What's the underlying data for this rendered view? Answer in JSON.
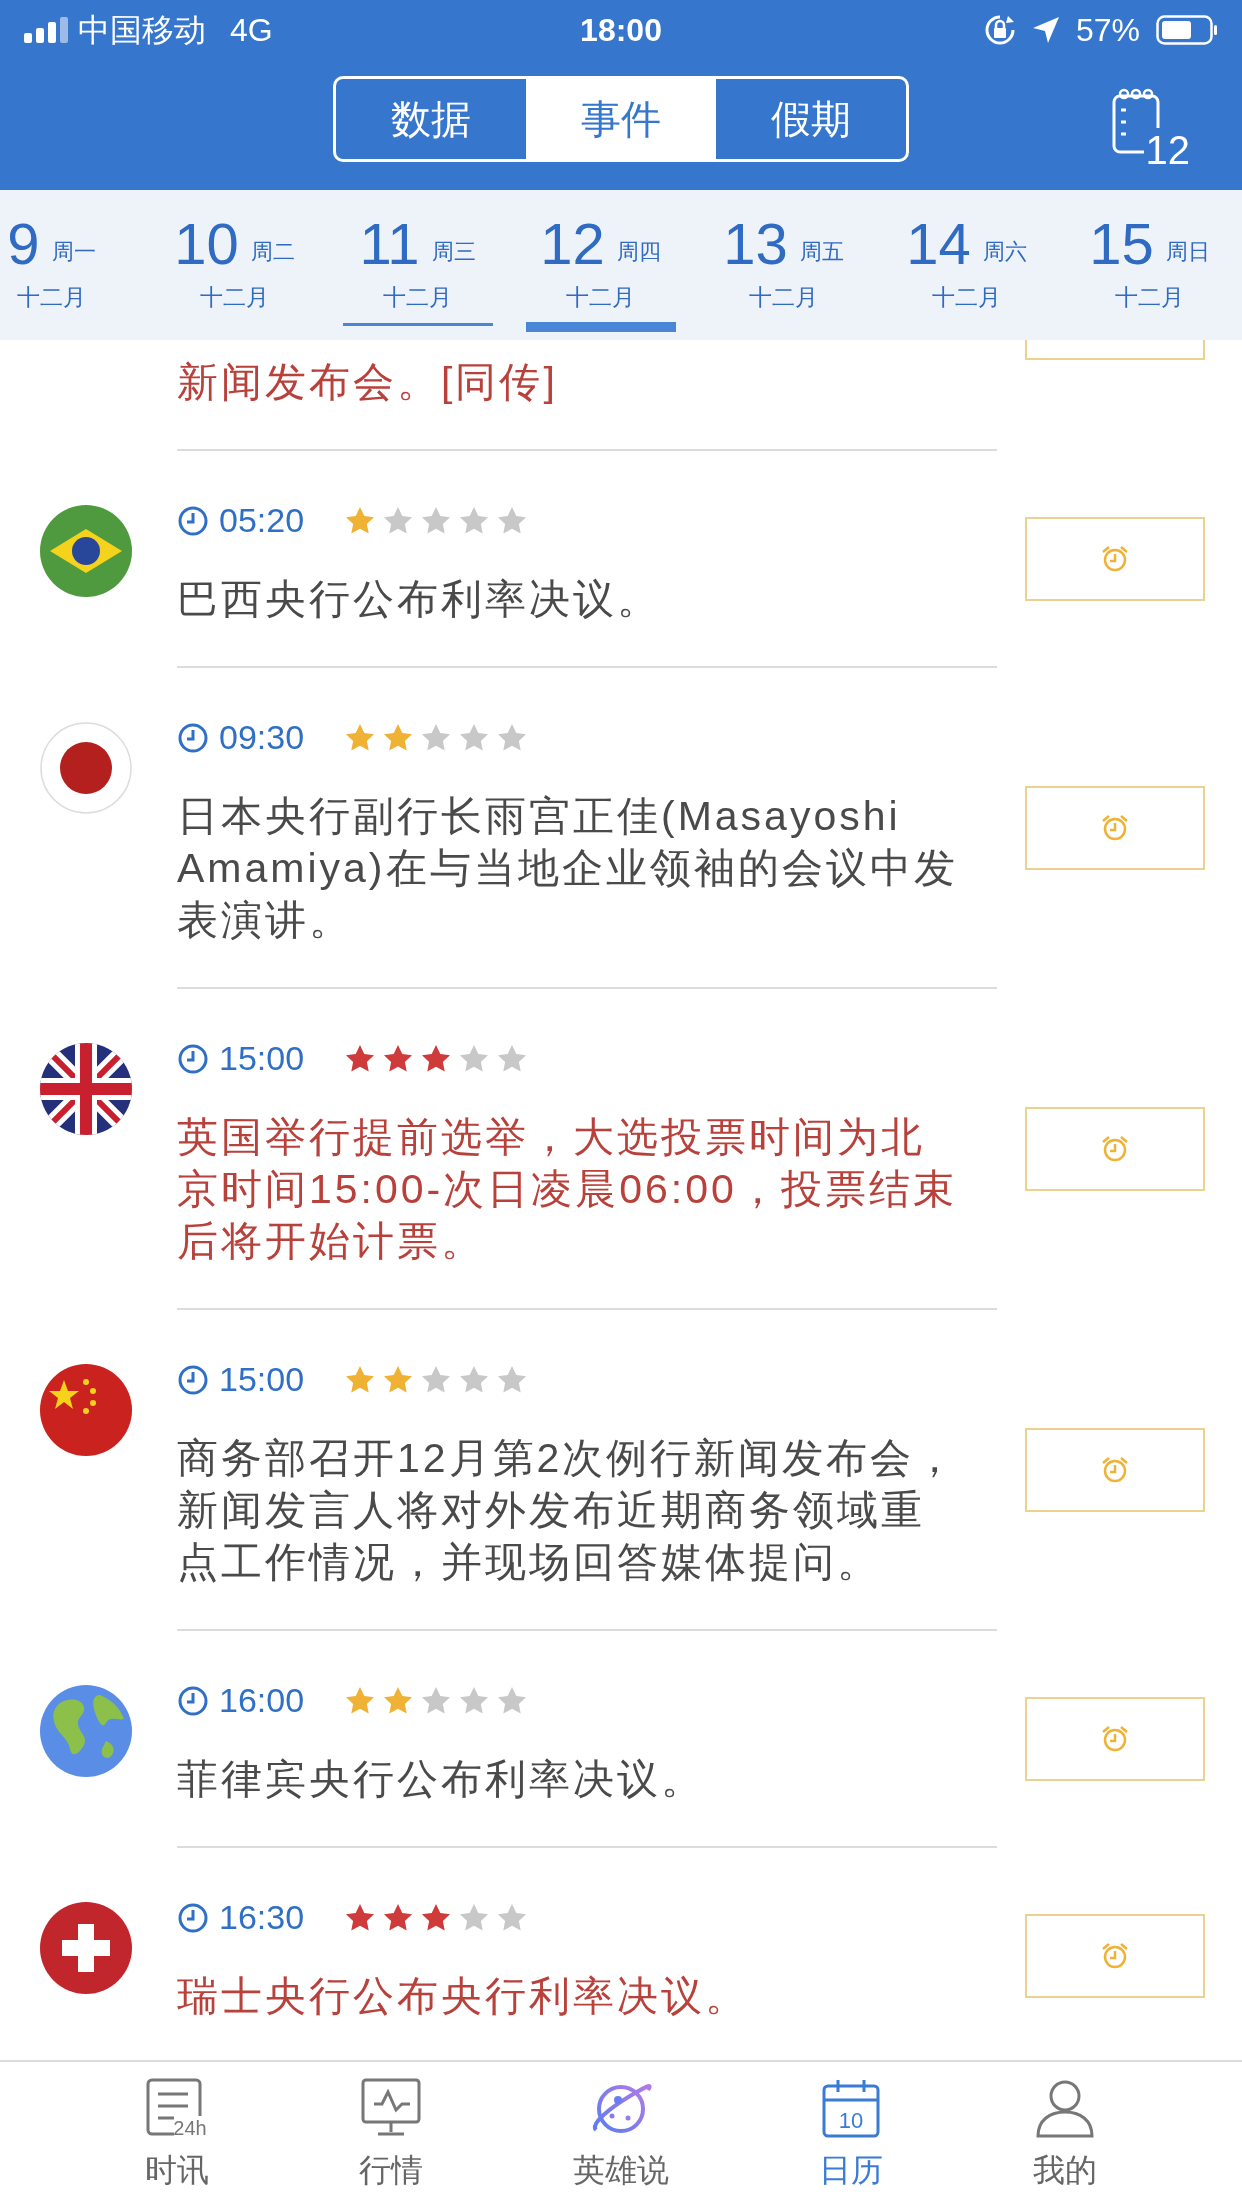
{
  "status_bar": {
    "carrier": "中国移动",
    "network": "4G",
    "time": "18:00",
    "battery": "57%"
  },
  "segments": [
    {
      "label": "数据",
      "selected": false
    },
    {
      "label": "事件",
      "selected": true
    },
    {
      "label": "假期",
      "selected": false
    }
  ],
  "calendar_button": {
    "label": "12"
  },
  "dates": [
    {
      "day": "9",
      "weekday": "周一",
      "month": "十二月",
      "selected": false,
      "today": false
    },
    {
      "day": "10",
      "weekday": "周二",
      "month": "十二月",
      "selected": false,
      "today": false
    },
    {
      "day": "11",
      "weekday": "周三",
      "month": "十二月",
      "selected": false,
      "today": true
    },
    {
      "day": "12",
      "weekday": "周四",
      "month": "十二月",
      "selected": true,
      "today": false
    },
    {
      "day": "13",
      "weekday": "周五",
      "month": "十二月",
      "selected": false,
      "today": false
    },
    {
      "day": "14",
      "weekday": "周六",
      "month": "十二月",
      "selected": false,
      "today": false
    },
    {
      "day": "15",
      "weekday": "周日",
      "month": "十二月",
      "selected": false,
      "today": false
    }
  ],
  "events": [
    {
      "kind": "partial",
      "text": "新闻发布会。[同传]",
      "important": true
    },
    {
      "kind": "full",
      "time": "05:20",
      "stars": 1,
      "text": "巴西央行公布利率决议。",
      "important": false
    },
    {
      "kind": "full",
      "time": "09:30",
      "stars": 2,
      "text": "日本央行副行长雨宫正佳(Masayoshi Amamiya)在与当地企业领袖的会议中发表演讲。",
      "important": false
    },
    {
      "kind": "full",
      "time": "15:00",
      "stars": 3,
      "text": "英国举行提前选举，大选投票时间为北京时间15:00-次日凌晨06:00，投票结束后将开始计票。",
      "important": true
    },
    {
      "kind": "full",
      "time": "15:00",
      "stars": 2,
      "text": "商务部召开12月第2次例行新闻发布会，新闻发言人将对外发布近期商务领域重点工作情况，并现场回答媒体提问。",
      "important": false
    },
    {
      "kind": "full",
      "time": "16:00",
      "stars": 2,
      "text": "菲律宾央行公布利率决议。",
      "important": false
    },
    {
      "kind": "full",
      "time": "16:30",
      "stars": 3,
      "text": "瑞士央行公布央行利率决议。",
      "important": true
    }
  ],
  "bottom_nav": [
    {
      "label": "时讯",
      "icon_text": "24h",
      "selected": false
    },
    {
      "label": "行情",
      "selected": false
    },
    {
      "label": "英雄说",
      "selected": false
    },
    {
      "label": "日历",
      "icon_text": "10",
      "selected": true
    },
    {
      "label": "我的",
      "selected": false
    }
  ]
}
